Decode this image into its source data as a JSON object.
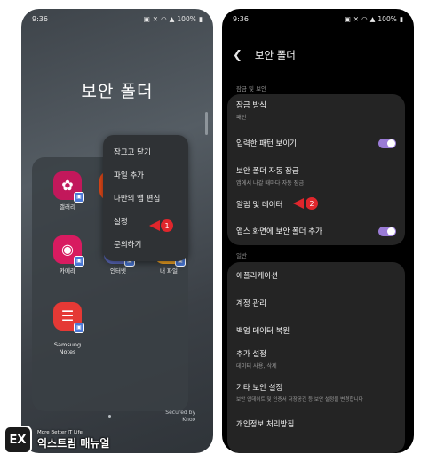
{
  "left_phone": {
    "status": {
      "time": "9:36",
      "battery": "100%"
    },
    "folder_title": "보안 폴더",
    "apps": [
      {
        "label": "갤러리",
        "icon": "gallery-icon",
        "color": "#c2185b"
      },
      {
        "label": "카메라",
        "icon": "camera-icon",
        "color": "#d81b60"
      },
      {
        "label": "인터넷",
        "icon": "internet-icon",
        "color": "#5c6bc0"
      },
      {
        "label": "내 파일",
        "icon": "my-files-icon",
        "color": "#f9a825"
      },
      {
        "label": "Samsung\nNotes",
        "icon": "notes-icon",
        "color": "#e53935"
      }
    ],
    "menu": [
      "잠그고 닫기",
      "파일 추가",
      "나만의 앱 편집",
      "설정",
      "문의하기"
    ],
    "secured_by": "Secured by\nKnox",
    "marker": "1"
  },
  "right_phone": {
    "status": {
      "time": "9:36",
      "battery": "100%"
    },
    "header_title": "보안 폴더",
    "section1_label": "잠금 및 보안",
    "section1_items": [
      {
        "title": "잠금 방식",
        "sub": "패턴"
      },
      {
        "title": "입력한 패턴 보이기",
        "toggle": true
      },
      {
        "title": "보안 폴더 자동 잠금",
        "sub": "앱에서 나갈 때마다 자동 잠금"
      },
      {
        "title": "알림 및 데이터"
      },
      {
        "title": "앱스 화면에 보안 폴더 추가",
        "toggle": true
      }
    ],
    "section2_label": "일반",
    "section2_items": [
      {
        "title": "애플리케이션"
      },
      {
        "title": "계정 관리"
      },
      {
        "title": "백업 데이터 복원"
      },
      {
        "title": "추가 설정",
        "sub": "데이터 사용, 삭제"
      },
      {
        "title": "기타 보안 설정",
        "sub": "보안 업데이트 및 인증서 저장공간 등 보안 설정을 변경합니다"
      },
      {
        "title": "개인정보 처리방침"
      }
    ],
    "marker": "2"
  },
  "watermark": {
    "logo": "EX",
    "tagline": "More Better IT Life",
    "name": "익스트림 매뉴얼"
  },
  "colors": {
    "marker_red": "#e0262c",
    "toggle_purple": "#9a7bd6",
    "card_bg": "#242424"
  }
}
